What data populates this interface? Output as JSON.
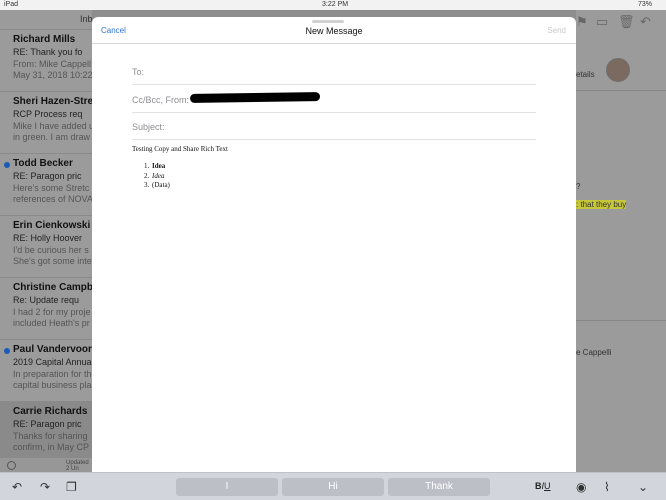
{
  "status_bar": {
    "device": "iPad",
    "time": "3:22 PM",
    "battery": "73%"
  },
  "mail_list": {
    "header": "Inb",
    "items": [
      {
        "sender": "Richard Mills",
        "subject": "RE: Thank you fo",
        "preview": "From: Mike Cappell\nMay 31, 2018 10:22",
        "unread": false,
        "selected": false
      },
      {
        "sender": "Sheri Hazen-Stret",
        "subject": "RCP Process req",
        "preview": "Mike I have added u\nin green. I am draw",
        "unread": false,
        "selected": false
      },
      {
        "sender": "Todd Becker",
        "subject": "RE: Paragon pric",
        "preview": "Here's some Stretc\nreferences of NOVA",
        "unread": true,
        "selected": false
      },
      {
        "sender": "Erin Cienkowski",
        "subject": "RE: Holly Hoover",
        "preview": "I'd be curious her s\nShe's got some inte",
        "unread": false,
        "selected": false
      },
      {
        "sender": "Christine Campb",
        "subject": "Re: Update requ",
        "preview": "I had 2 for my proje\nincluded Heath's pr",
        "unread": false,
        "selected": false
      },
      {
        "sender": "Paul Vandervoort",
        "subject": "2019 Capital Annua",
        "preview": "In preparation for th\ncapital business pla",
        "unread": true,
        "selected": false
      },
      {
        "sender": "Carrie Richards",
        "subject": "RE: Paragon pric",
        "preview": "Thanks for sharing\nconfirm, in May CP",
        "unread": false,
        "selected": true
      }
    ],
    "footer": "Updated\n2 Un"
  },
  "detail": {
    "details_link": "etails",
    "question_fragment": "?",
    "highlight_text": ": that they buy",
    "name_fragment": "e Cappelli"
  },
  "compose": {
    "cancel_label": "Cancel",
    "title": "New Message",
    "send_label": "Send",
    "to_label": "To:",
    "cc_label": "Cc/Bcc, From:",
    "subject_label": "Subject:",
    "body_intro": "Testing Copy and Share Rich Text",
    "list_items": [
      {
        "num": "1.",
        "text": "Idea",
        "style": "bold"
      },
      {
        "num": "2.",
        "text": "Idea",
        "style": "italic"
      },
      {
        "num": "3.",
        "text": "(Data)",
        "style": "plain"
      }
    ]
  },
  "keyboard_bar": {
    "suggestions": [
      "I",
      "Hi",
      "Thank"
    ],
    "format_b": "B",
    "format_i": "I",
    "format_u": "U"
  },
  "colors": {
    "accent": "#2f74d0",
    "unread_dot": "#1a5bb8",
    "highlight": "#c6c63a"
  }
}
